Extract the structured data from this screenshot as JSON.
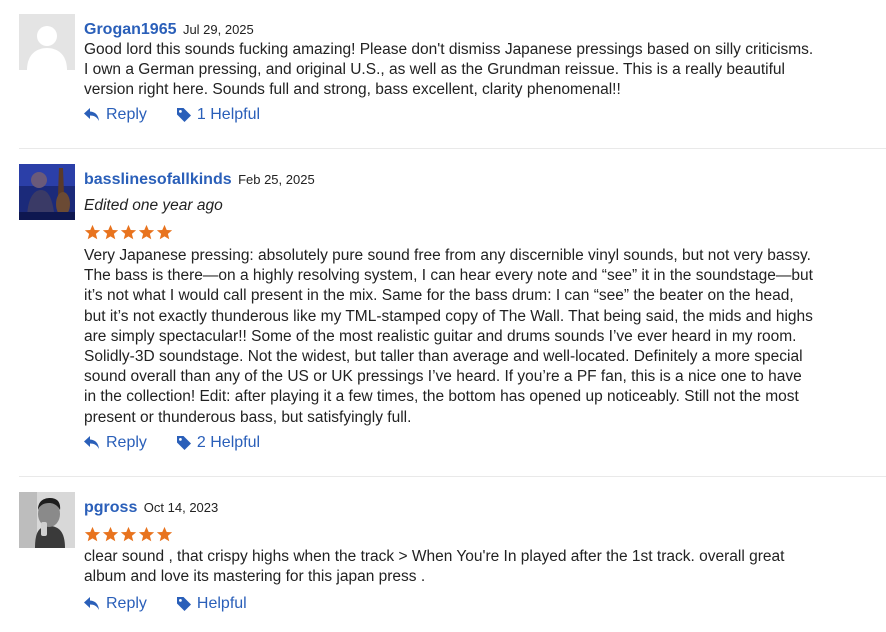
{
  "reviews": [
    {
      "username": "Grogan1965",
      "date": "Jul 29, 2025",
      "edited": null,
      "rating": 0,
      "text": "Good lord this sounds fucking amazing! Please don't dismiss Japanese pressings based on silly criticisms. I own a German pressing, and original U.S., as well as the Grundman reissue. This is a really beautiful version right here. Sounds full and strong, bass excellent, clarity phenomenal!!",
      "reply_label": "Reply",
      "helpful_label": "1 Helpful",
      "avatar": "default-avatar"
    },
    {
      "username": "basslinesofallkinds",
      "date": "Feb 25, 2025",
      "edited": "Edited one year ago",
      "rating": 5,
      "text": "Very Japanese pressing: absolutely pure sound free from any discernible vinyl sounds, but not very bassy. The bass is there—on a highly resolving system, I can hear every note and “see” it in the soundstage—but it’s not what I would call present in the mix. Same for the bass drum: I can “see” the beater on the head, but it’s not exactly thunderous like my TML-stamped copy of The Wall. That being said, the mids and highs are simply spectacular!! Some of the most realistic guitar and drums sounds I’ve ever heard in my room. Solidly-3D soundstage. Not the widest, but taller than average and well-located. Definitely a more special sound overall than any of the US or UK pressings I’ve heard. If you’re a PF fan, this is a nice one to have in the collection! Edit: after playing it a few times, the bottom has opened up noticeably. Still not the most present or thunderous bass, but satisfyingly full.",
      "reply_label": "Reply",
      "helpful_label": "2 Helpful",
      "avatar": "photo-avatar-blue"
    },
    {
      "username": "pgross",
      "date": "Oct 14, 2023",
      "edited": null,
      "rating": 5,
      "text": "clear sound , that crispy highs when the track > When You're In played after the 1st track. overall great album and love its mastering for this japan press .",
      "reply_label": "Reply",
      "helpful_label": "Helpful",
      "avatar": "photo-avatar-bw"
    }
  ],
  "colors": {
    "link": "#2a5fb9",
    "star": "#e8731e",
    "divider": "#e9e9e9"
  },
  "icons": {
    "reply": "reply-arrow-icon",
    "helpful": "tag-icon",
    "star": "star-icon"
  }
}
